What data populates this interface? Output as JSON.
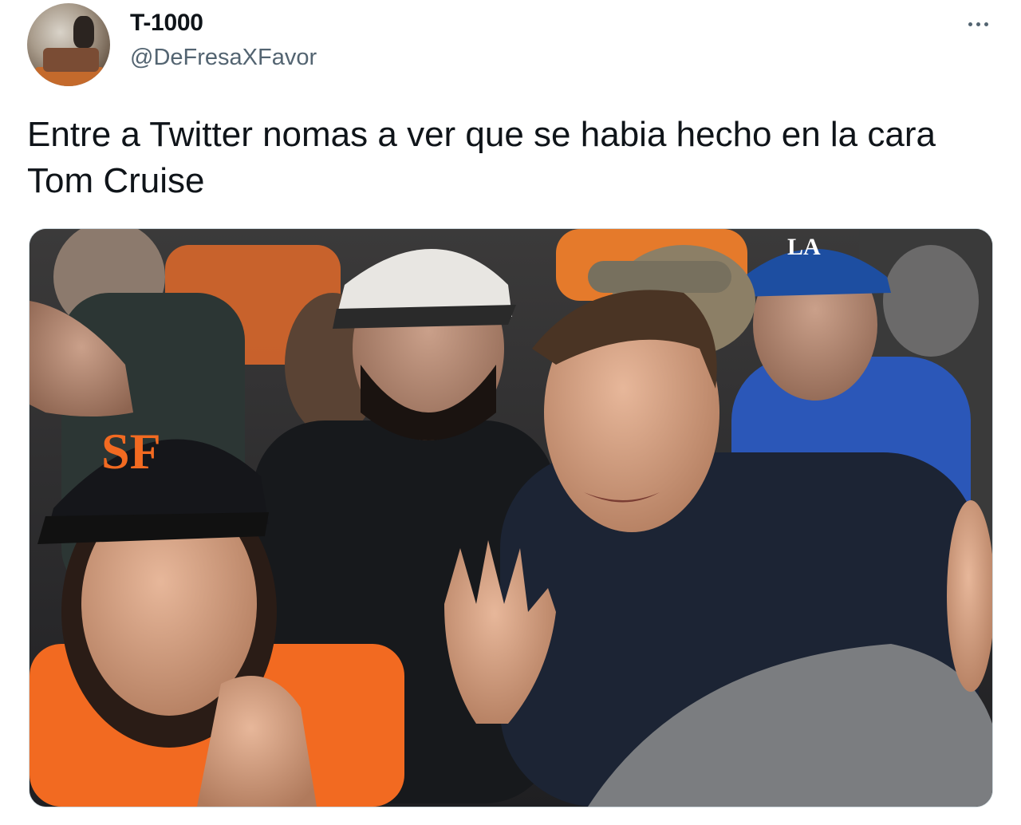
{
  "author": {
    "display_name": "T-1000",
    "handle": "@DeFresaXFavor",
    "avatar_icon": "profile-photo"
  },
  "menu": {
    "more_icon": "ellipsis-icon"
  },
  "tweet": {
    "text": "Entre a Twitter nomas a ver que se habia hecho en la cara Tom Cruise",
    "media_alt": "photo",
    "cap_logo_left": "SF",
    "cap_logo_right": "LA"
  },
  "colors": {
    "text_primary": "#0f1419",
    "text_secondary": "#536471",
    "giants_orange": "#f26a21",
    "dodgers_blue": "#1d4ea1"
  }
}
